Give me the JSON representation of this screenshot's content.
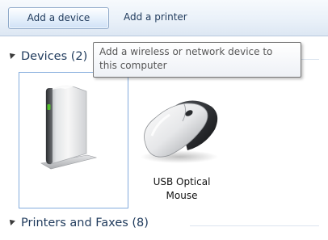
{
  "toolbar": {
    "add_device_label": "Add a device",
    "add_printer_label": "Add a printer"
  },
  "tooltip": {
    "text": "Add a wireless or network device to\nthis computer"
  },
  "groups": {
    "devices": {
      "header": "Devices (2)",
      "items": [
        {
          "name": "",
          "icon": "external-drive-icon",
          "selected": true
        },
        {
          "name": "USB Optical\nMouse",
          "icon": "mouse-icon",
          "selected": false
        }
      ]
    },
    "printers": {
      "header": "Printers and Faxes (8)"
    }
  },
  "colors": {
    "text": "#1e395b",
    "selection_border": "#84acdd",
    "drive_status_light": "#54c12c"
  }
}
